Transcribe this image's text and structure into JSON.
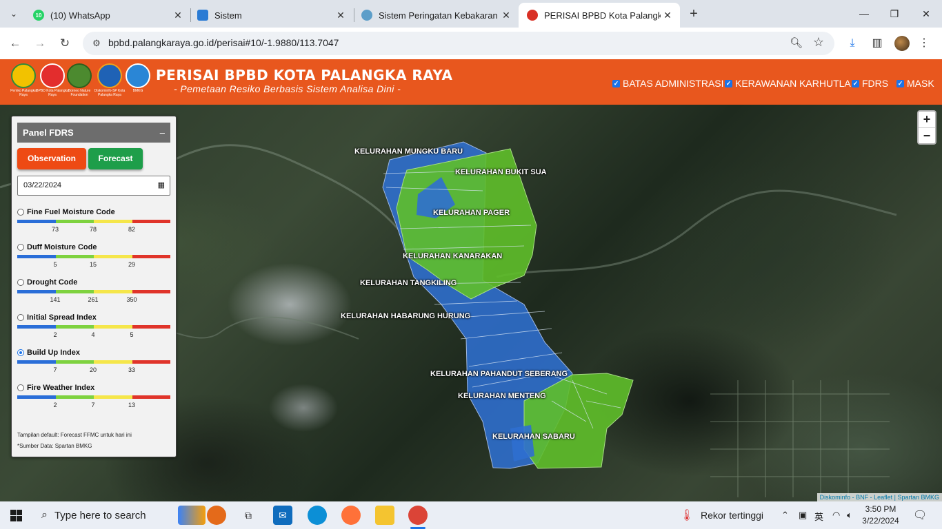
{
  "browser": {
    "tabs": [
      {
        "title": "(10) WhatsApp",
        "badge": "10",
        "color": "#25d366",
        "icon": "whatsapp-icon"
      },
      {
        "title": "Sistem",
        "color": "#2a7bd4",
        "icon": "site-icon"
      },
      {
        "title": "Sistem Peringatan Kebakaran H",
        "color": "#5c9ec9",
        "icon": "globe-icon"
      },
      {
        "title": "PERISAI BPBD Kota Palangka Ra",
        "color": "#d93025",
        "icon": "bpbd-icon"
      }
    ],
    "url": "bpbd.palangkaraya.go.id/perisai#10/-1.9880/113.7047"
  },
  "header": {
    "logos": [
      {
        "caption": "Pemko Palangka Raya",
        "color": "#f2c200"
      },
      {
        "caption": "BPBD Kota Palangka Raya",
        "color": "#e32d2d"
      },
      {
        "caption": "Borneo Nature Foundation",
        "color": "#4c8a2f"
      },
      {
        "caption": "Diskominfo-SP Kota Palangka Raya",
        "color": "#1f62b5"
      },
      {
        "caption": "BMKG",
        "color": "#2a86d6"
      }
    ],
    "title": "PERISAI BPBD KOTA PALANGKA RAYA",
    "tagline": "- Pemetaan Resiko Berbasis Sistem Analisa Dini -",
    "layers": [
      {
        "label": "BATAS ADMINISTRASI",
        "checked": true
      },
      {
        "label": "KERAWANAN KARHUTLA",
        "checked": true
      },
      {
        "label": "FDRS",
        "checked": true
      },
      {
        "label": "MASK",
        "checked": true
      }
    ]
  },
  "panel": {
    "title": "Panel FDRS",
    "collapse": "–",
    "observation_label": "Observation",
    "forecast_label": "Forecast",
    "date": "03/22/2024",
    "scale_colors": [
      "#2a6ed8",
      "#7ed23f",
      "#f5e64a",
      "#e0342a"
    ],
    "indices": [
      {
        "label": "Fine Fuel Moisture Code",
        "ticks": [
          "73",
          "78",
          "82"
        ],
        "selected": false
      },
      {
        "label": "Duff Moisture Code",
        "ticks": [
          "5",
          "15",
          "29"
        ],
        "selected": false
      },
      {
        "label": "Drought Code",
        "ticks": [
          "141",
          "261",
          "350"
        ],
        "selected": false
      },
      {
        "label": "Initial Spread Index",
        "ticks": [
          "2",
          "4",
          "5"
        ],
        "selected": false
      },
      {
        "label": "Build Up Index",
        "ticks": [
          "7",
          "20",
          "33"
        ],
        "selected": true
      },
      {
        "label": "Fire Weather Index",
        "ticks": [
          "2",
          "7",
          "13"
        ],
        "selected": false
      }
    ],
    "note_default": "Tampilan default: Forecast FFMC untuk hari ini",
    "note_source": "*Sumber Data: Spartan BMKG"
  },
  "map": {
    "kelurahan": [
      "KELURAHAN MUNGKU BARU",
      "KELURAHAN BUKIT SUA",
      "KELURAHAN PAGER",
      "KELURAHAN KANARAKAN",
      "KELURAHAN TANGKILING",
      "KELURAHAN HABARUNG HURUNG",
      "KELURAHAN PAHANDUT SEBERANG",
      "KELURAHAN MENTENG",
      "KELURAHAN SABARU"
    ],
    "zoom_in": "+",
    "zoom_out": "−",
    "attribution": "Diskominfo - BNF - Leaflet | Spartan BMKG",
    "risk_colors": {
      "low": "#2f6fd0",
      "moderate": "#5fbf2a"
    }
  },
  "taskbar": {
    "search_placeholder": "Type here to search",
    "weather": "Rekor tertinggi",
    "time": "3:50 PM",
    "date": "3/22/2024"
  }
}
